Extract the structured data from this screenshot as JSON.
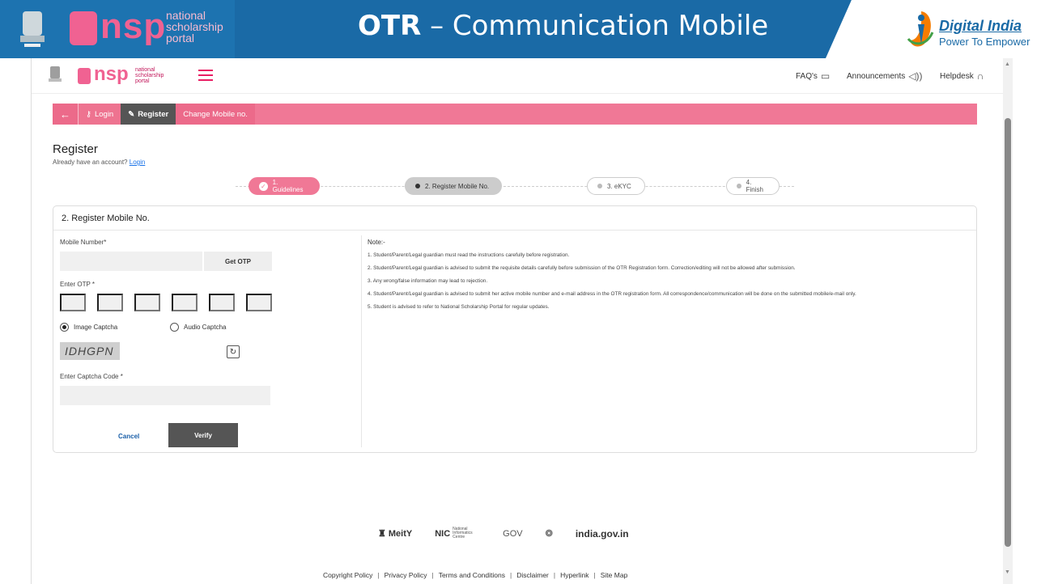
{
  "slide": {
    "nsp_logo_text": "nsp",
    "nsp_logo_sub": "national scholarship portal",
    "title_bold": "OTR",
    "title_rest": " – Communication Mobile",
    "digital_india": "Digital India",
    "digital_india_tagline": "Power To Empower"
  },
  "app_header": {
    "logo_text": "nsp",
    "logo_sub": "national scholarship portal",
    "faqs": "FAQ's",
    "announcements": "Announcements",
    "helpdesk": "Helpdesk"
  },
  "breadcrumbs": {
    "back": "←",
    "login": "Login",
    "register": "Register",
    "change_mobile": "Change Mobile no."
  },
  "register": {
    "title": "Register",
    "already": "Already have an account?",
    "login_link": "Login"
  },
  "steps": [
    {
      "label": "1. Guidelines",
      "state": "done"
    },
    {
      "label": "2. Register Mobile No.",
      "state": "active"
    },
    {
      "label": "3. eKYC",
      "state": "pending"
    },
    {
      "label": "4. Finish",
      "state": "pending"
    }
  ],
  "form": {
    "heading": "2. Register Mobile No.",
    "mobile_label": "Mobile Number*",
    "mobile_value": "",
    "get_otp": "Get OTP",
    "otp_label": "Enter OTP *",
    "image_captcha": "Image Captcha",
    "audio_captcha": "Audio Captcha",
    "selected_captcha": "image",
    "captcha_text": "IDHGPN",
    "captcha_code_label": "Enter Captcha Code *",
    "captcha_code_value": "",
    "cancel": "Cancel",
    "verify": "Verify"
  },
  "notes": {
    "title": "Note:-",
    "items": [
      "1. Student/Parent/Legal guardian must read the instructions carefully before registration.",
      "2. Student/Parent/Legal guardian is advised to submit the requisite details carefully before submission of the OTR Registration form. Correction/editing will not be allowed after submission.",
      "3. Any wrong/false information may lead to rejection.",
      "4. Student/Parent/Legal guardian is advised to submit her active mobile number and e-mail address in the OTR registration form. All correspondence/communication will be done on the submitted mobile/e-mail only.",
      "5. Student is advised to refer to National Scholarship Portal for regular updates."
    ]
  },
  "footer": {
    "logos": {
      "meity": "MeitY",
      "nic": "NIC",
      "nic_sub": "National Informatics Centre",
      "mygov": "GOV",
      "indiagov": "india.gov.in"
    },
    "links": [
      "Copyright Policy",
      "Privacy Policy",
      "Terms and Conditions",
      "Disclaimer",
      "Hyperlink",
      "Site Map"
    ]
  },
  "colors": {
    "banner_blue": "#1a6aa6",
    "nsp_pink": "#f06292",
    "crumb_pink": "#f07896",
    "active_dark": "#555555"
  }
}
